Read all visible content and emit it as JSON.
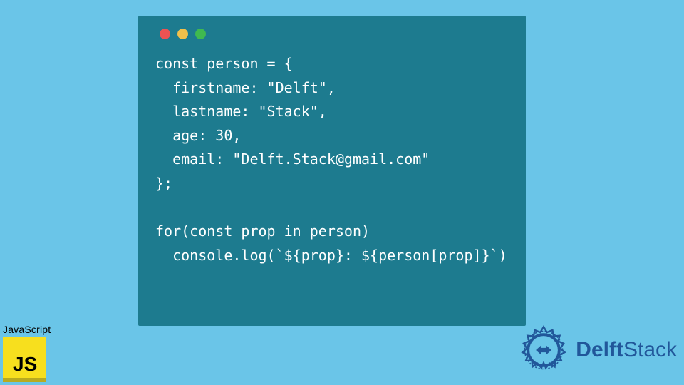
{
  "code": {
    "line1": "const person = {",
    "line2": "  firstname: \"Delft\",",
    "line3": "  lastname: \"Stack\",",
    "line4": "  age: 30,",
    "line5": "  email: \"Delft.Stack@gmail.com\"",
    "line6": "};",
    "line7": "",
    "line8": "for(const prop in person)",
    "line9": "  console.log(`${prop}: ${person[prop]}`)"
  },
  "jsBadge": {
    "label": "JavaScript",
    "logoText": "JS"
  },
  "brand": {
    "name": "DelftStack",
    "part1": "Delft",
    "part2": "Stack"
  },
  "colors": {
    "bg": "#6ac5e8",
    "windowBg": "#1d7b8f",
    "jsYellow": "#f7df1e",
    "brandBlue": "#21579a"
  }
}
